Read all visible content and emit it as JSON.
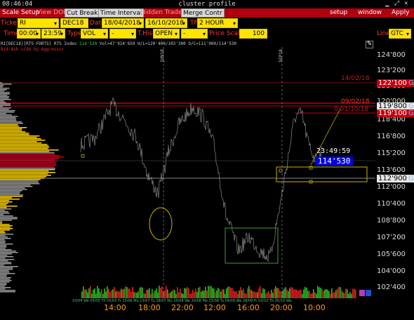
{
  "titlebar": {
    "clock": "08:46:04",
    "title": "cluster profile"
  },
  "row1": {
    "scale_setup": "Scale Setup",
    "view_dom": "View DOM",
    "cut_breaks": "Cut Breaks",
    "time_interval": "Time Interval",
    "hidden_trades": "Hidden Trades",
    "merge_contr": "Merge Contr",
    "setup": "setup",
    "window": "window",
    "apply": "Apply"
  },
  "row2": {
    "ticker_label": "Ticker",
    "ticker_value": "RI",
    "contract_value": "DEC18",
    "date_label": "Date",
    "date_from": "18/04/2018",
    "date_to": "16/10/2018",
    "tf_label": "TF",
    "tf_value": "2 HOUR"
  },
  "row3": {
    "time_label": "Time",
    "time_from": "00:00",
    "time_to": "23:59",
    "type_label": "Type",
    "type_value": "VOL",
    "type_sub": "-",
    "thist_label": "T.Hist",
    "thist_value": "OPEN",
    "thist_sub": "-",
    "price_scale_label": "Price Scale",
    "price_scale_value": "100",
    "line_label": "Line",
    "line_value": "GTC"
  },
  "chart": {
    "header": "RI[DEC18][RTS FORTS] RTS Index",
    "header_last": "114'530",
    "header_stats": "Vol=47'914'659 H/L=120'400/103'300 O/C=111'900/114'530",
    "header2": "Bid-Ask side by Aggressor",
    "month_markers": [
      "JUN18",
      "SEP18"
    ],
    "price_ticks": [
      "124'800",
      "123'200",
      "121'600",
      "120'000",
      "118'400",
      "116'800",
      "115'200",
      "113'600",
      "112'000",
      "110'400",
      "108'800",
      "107'200",
      "105'600",
      "104'000",
      "102'400"
    ],
    "price_tags": [
      {
        "text": "122'100",
        "g": "G",
        "style": "red"
      },
      {
        "text": "119'800",
        "g": "G",
        "style": "white"
      },
      {
        "text": "119'100",
        "g": "G",
        "style": "red"
      },
      {
        "text": "112'900",
        "g": "G",
        "style": "white"
      }
    ],
    "level_labels": [
      "14/02/18",
      "09/02/18",
      "0 01/10/18"
    ],
    "clock": "23:49:59",
    "last_price": "114'530",
    "time_ticks": [
      "14:00",
      "18:00",
      "22:00",
      "12:00",
      "16:00",
      "20:00",
      "10:00"
    ],
    "date_labels": "10/04 We 05/05 Th 25/05 Fr 15/06 Mo 13/07 Tu 28/07 Mo 15/08 We 20/08 Mo 25/08 Tu 04/09 We 28/09 Fr 03/10 Th 05/10 We",
    "volume_colors": {
      "up": "#22c022",
      "down": "#e02020"
    }
  },
  "colors": {
    "accent": "#b00010",
    "field": "#ffe400",
    "label": "#ff3b2f",
    "grid_text": "#dddddd"
  }
}
